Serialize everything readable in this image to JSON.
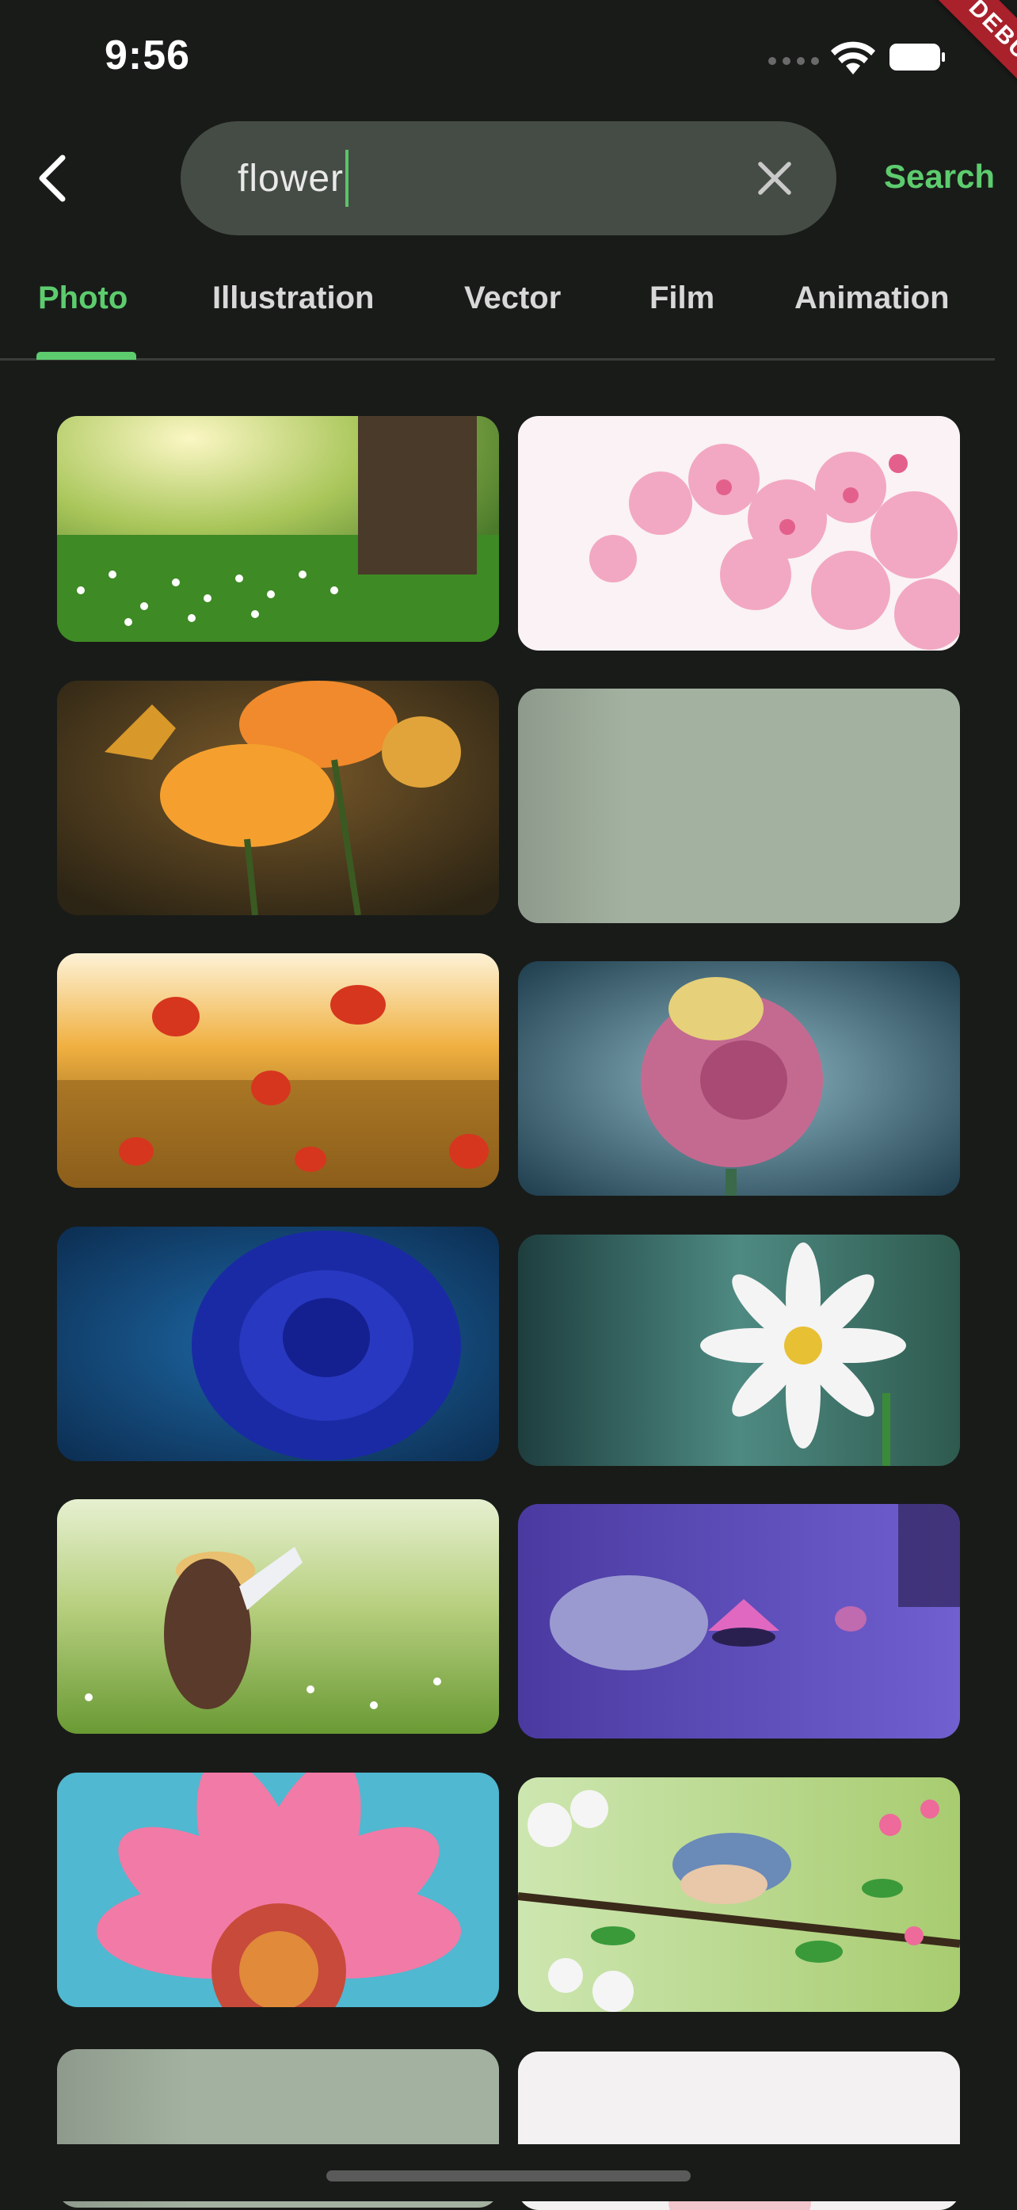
{
  "status_bar": {
    "time": "9:56",
    "debug_label": "DEBUG",
    "icons": [
      "cellular-signal-icon",
      "wifi-icon",
      "battery-icon"
    ]
  },
  "header": {
    "back_icon": "chevron-left-icon",
    "search_value": "flower",
    "clear_icon": "close-icon",
    "search_action_label": "Search"
  },
  "tabs": [
    {
      "label": "Photo",
      "active": true
    },
    {
      "label": "Illustration",
      "active": false
    },
    {
      "label": "Vector",
      "active": false
    },
    {
      "label": "Film",
      "active": false
    },
    {
      "label": "Animation",
      "active": false
    }
  ],
  "colors": {
    "background": "#191b19",
    "accent": "#5dcc6e",
    "search_bg": "#454c45",
    "placeholder_tile": "#9aa898"
  },
  "results": [
    {
      "name": "meadow-flowers-tree-photo"
    },
    {
      "name": "pink-cherry-blossom-photo"
    },
    {
      "name": "orange-flowers-butterfly-photo"
    },
    {
      "name": "loading-placeholder"
    },
    {
      "name": "poppies-sunset-field-photo"
    },
    {
      "name": "pink-rose-photo"
    },
    {
      "name": "blue-rose-photo"
    },
    {
      "name": "white-daisy-photo"
    },
    {
      "name": "girl-in-meadow-photo"
    },
    {
      "name": "water-lily-pond-photo"
    },
    {
      "name": "pink-gerbera-photo"
    },
    {
      "name": "bird-on-blossom-branch-photo"
    },
    {
      "name": "loading-placeholder"
    },
    {
      "name": "white-flower-photo"
    }
  ]
}
